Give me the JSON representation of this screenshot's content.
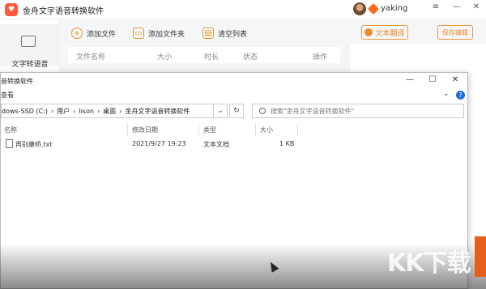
{
  "app": {
    "title": "金舟文字语音转换软件",
    "logo_glyph": "♥",
    "user_name": "yaking",
    "controls": {
      "menu": "≡",
      "minimize": "—",
      "close": "✕"
    }
  },
  "sidebar": {
    "items": [
      {
        "label": "文字转语音",
        "icon": "text-to-speech-icon"
      }
    ]
  },
  "toolbar": {
    "add_file": "添加文件",
    "add_folder": "添加文件夹",
    "clear_list": "清空列表",
    "translate": "文本翻译",
    "save_edit": "保存编辑"
  },
  "list_header": {
    "name": "文件名称",
    "size": "大小",
    "duration": "时长",
    "status": "状态",
    "action": "操作"
  },
  "explorer": {
    "title": "音转换软件",
    "menu": "查看",
    "controls": {
      "minimize": "—",
      "maximize": "☐",
      "close": "✕"
    },
    "breadcrumb": [
      "dows-SSD (C:)",
      "用户",
      "lison",
      "桌面",
      "金舟文字语音转换软件"
    ],
    "breadcrumb_sep": "›",
    "dropdown_glyph": "⌄",
    "refresh_glyph": "↻",
    "search_placeholder": "搜索\"金舟文字语音转换软件\"",
    "columns": {
      "name": "名称",
      "modified": "修改日期",
      "type": "类型",
      "size": "大小"
    },
    "files": [
      {
        "name": "再别康桥.txt",
        "modified": "2021/9/27 19:23",
        "type": "文本文档",
        "size": "1 KB"
      }
    ],
    "help_glyph": "?",
    "chevron_glyph": "⌄"
  },
  "watermark": "KK下载",
  "colors": {
    "accent": "#f08a2c",
    "brand": "#ff5a3c",
    "help": "#1e6fd9"
  }
}
